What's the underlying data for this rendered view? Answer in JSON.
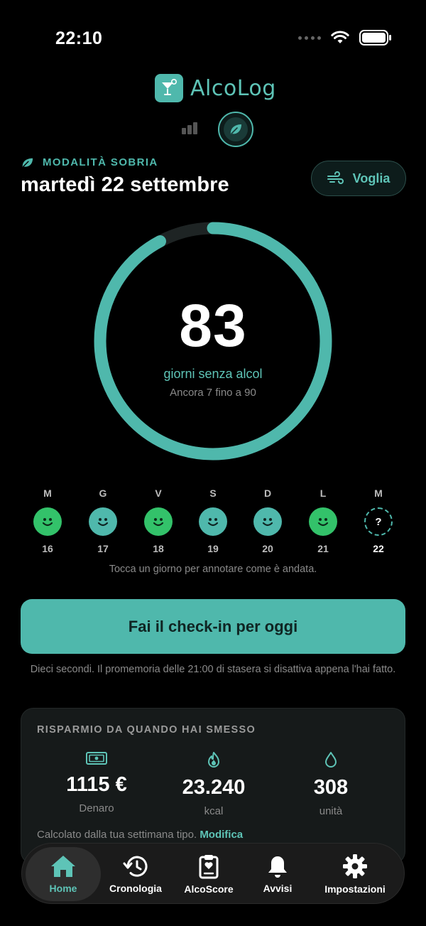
{
  "status_bar": {
    "time": "22:10"
  },
  "app": {
    "name": "AlcoLog"
  },
  "mode": {
    "label": "MODALITÀ SOBRIA"
  },
  "header": {
    "date": "martedì 22 settembre",
    "craving_button": "Voglia"
  },
  "streak": {
    "days": "83",
    "label": "giorni senza alcol",
    "sub": "Ancora 7 fino a 90",
    "progress": 0.922
  },
  "week": {
    "days": [
      {
        "letter": "M",
        "num": "16",
        "mood": "green"
      },
      {
        "letter": "G",
        "num": "17",
        "mood": "teal"
      },
      {
        "letter": "V",
        "num": "18",
        "mood": "green"
      },
      {
        "letter": "S",
        "num": "19",
        "mood": "teal"
      },
      {
        "letter": "D",
        "num": "20",
        "mood": "teal"
      },
      {
        "letter": "L",
        "num": "21",
        "mood": "green"
      },
      {
        "letter": "M",
        "num": "22",
        "mood": "unknown",
        "mark": "?"
      }
    ],
    "hint": "Tocca un giorno per annotare come è andata."
  },
  "checkin": {
    "button": "Fai il check-in per oggi",
    "hint": "Dieci secondi. Il promemoria delle 21:00 di stasera si disattiva appena l'hai fatto."
  },
  "savings": {
    "title": "RISPARMIO DA QUANDO HAI SMESSO",
    "money": {
      "value": "1115 €",
      "label": "Denaro"
    },
    "kcal": {
      "value": "23.240",
      "label": "kcal"
    },
    "units": {
      "value": "308",
      "label": "unità"
    },
    "note": "Calcolato dalla tua settimana tipo.",
    "note_link": "Modifica"
  },
  "tabs": [
    {
      "label": "Home",
      "icon": "home-icon",
      "active": true
    },
    {
      "label": "Cronologia",
      "icon": "history-icon"
    },
    {
      "label": "AlcoScore",
      "icon": "clipboard-heart-icon"
    },
    {
      "label": "Avvisi",
      "icon": "bell-icon"
    },
    {
      "label": "Impostazioni",
      "icon": "gear-icon"
    }
  ],
  "colors": {
    "accent": "#4fb8ac",
    "green": "#33c26a",
    "background": "#000000"
  }
}
